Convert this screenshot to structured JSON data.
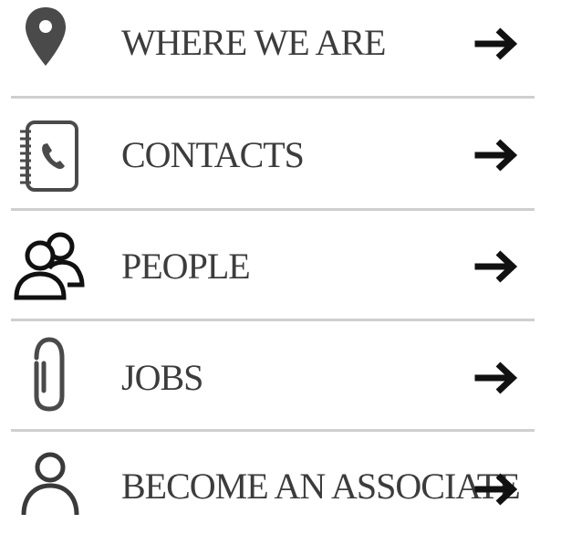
{
  "menu": {
    "items": [
      {
        "label": "WHERE WE ARE",
        "icon": "location-pin-icon"
      },
      {
        "label": "CONTACTS",
        "icon": "address-book-icon"
      },
      {
        "label": "PEOPLE",
        "icon": "people-icon"
      },
      {
        "label": "JOBS",
        "icon": "paperclip-icon"
      },
      {
        "label": "BECOME AN ASSOCIATE",
        "icon": "person-icon"
      }
    ],
    "arrow_icon": "arrow-right-icon"
  },
  "colors": {
    "text": "#3c3c3c",
    "icon": "#4a4a4a",
    "arrow": "#111111",
    "divider": "#cfcfcf",
    "background": "#ffffff"
  }
}
